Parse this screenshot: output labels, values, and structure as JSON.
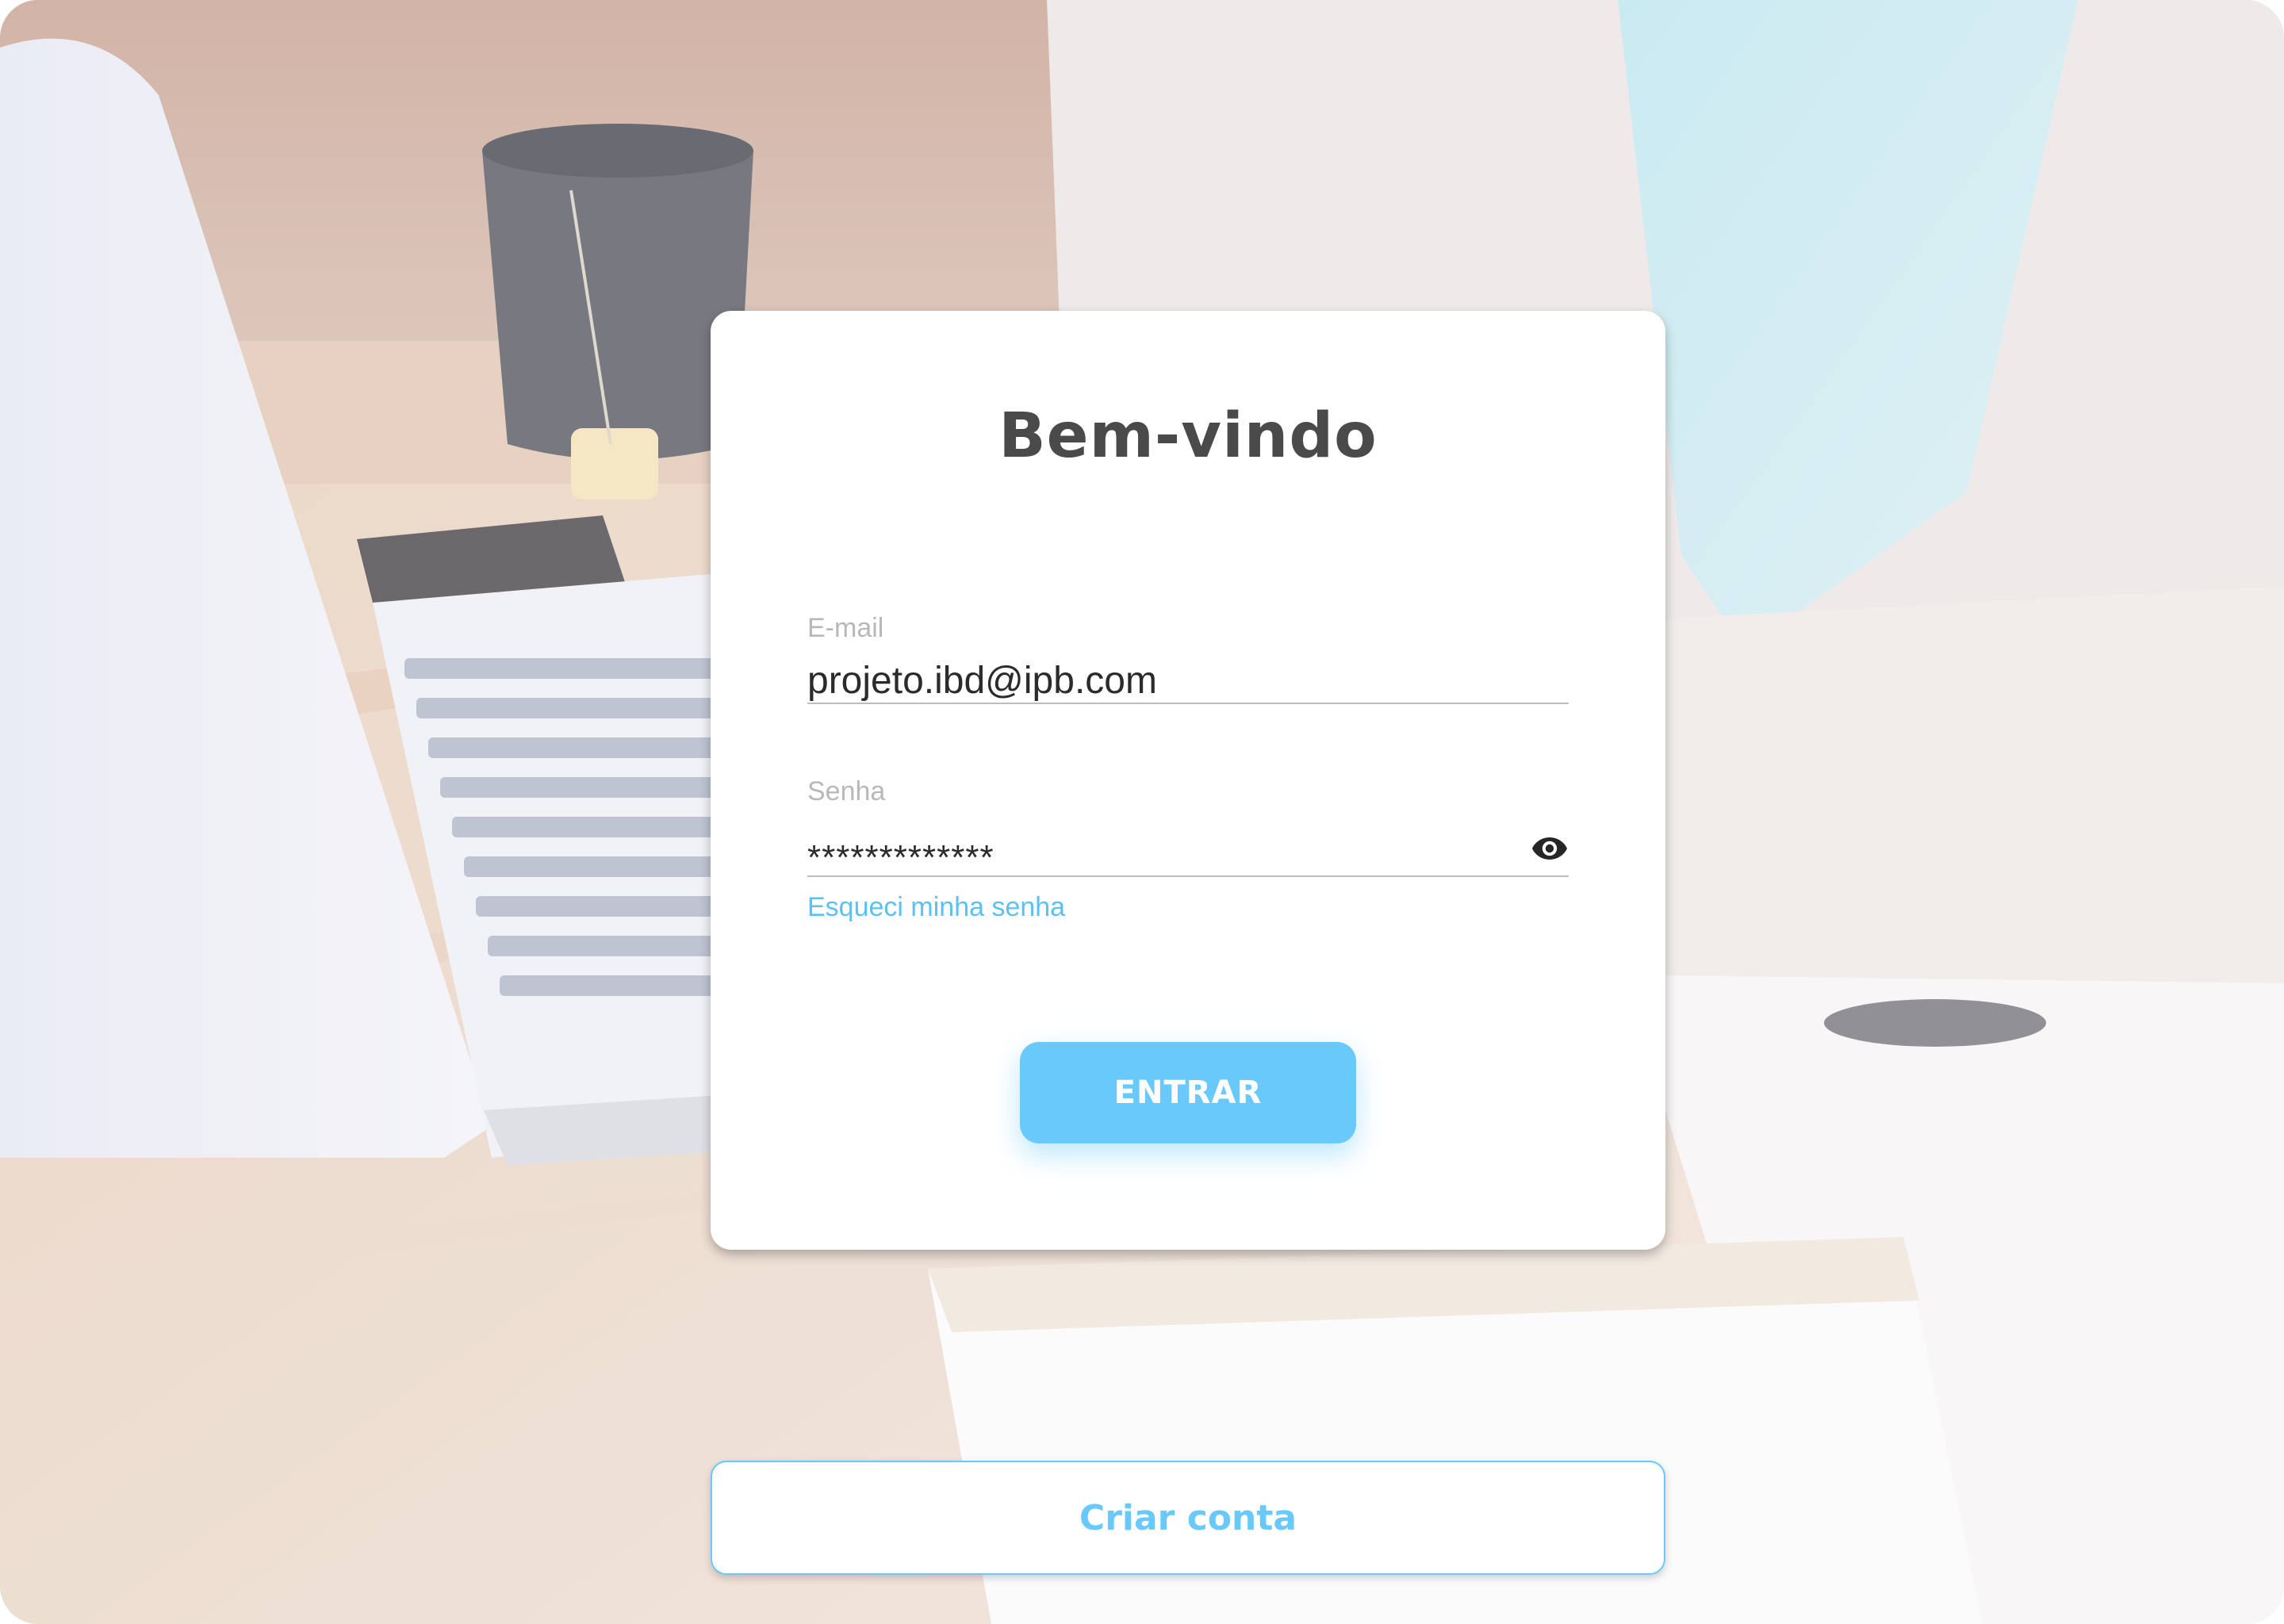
{
  "login": {
    "title": "Bem-vindo",
    "email": {
      "label": "E-mail",
      "value": "projeto.ibd@ipb.com"
    },
    "password": {
      "label": "Senha",
      "value": "*************"
    },
    "forgot_password_link": "Esqueci minha senha",
    "submit_label": "ENTRAR",
    "create_account_label": "Criar conta"
  },
  "icons": {
    "password_toggle": "eye-icon"
  },
  "colors": {
    "accent": "#6ac9fb",
    "link": "#5bc1f3",
    "title": "#4a4a4a",
    "label": "#b8b8b8",
    "card": "#ffffff"
  }
}
